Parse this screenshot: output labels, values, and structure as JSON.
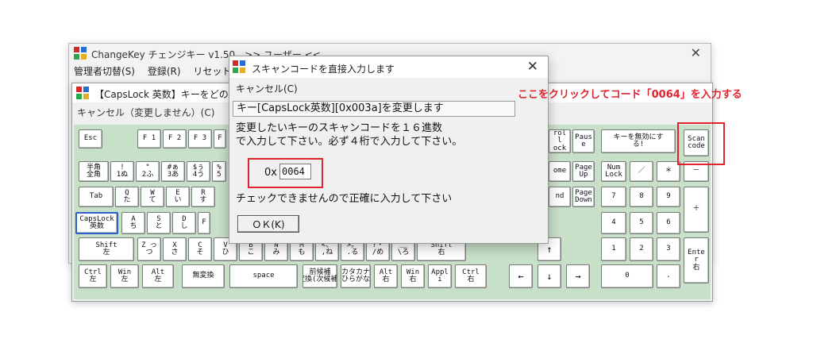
{
  "colors": {
    "accent_red": "#e0232e",
    "keyboard_bg": "#c8dfc8",
    "selected_key_border": "#2f5fc8"
  },
  "main_window": {
    "title": "ChangeKey チェンジキー v1.50　>> ユーザー <<",
    "close_label": "✕",
    "menu": [
      "管理者切替(S)",
      "登録(R)",
      "リセット"
    ]
  },
  "keyboard_window": {
    "title": "【CapsLock 英数】キーをどのキー",
    "menu_label": "キャンセル（変更しません）(C)",
    "keys": [
      {
        "id": "esc",
        "label": "Esc"
      },
      {
        "id": "f1",
        "label": "F 1"
      },
      {
        "id": "f2",
        "label": "F 2"
      },
      {
        "id": "f3",
        "label": "F 3"
      },
      {
        "id": "f4",
        "label": "F"
      },
      {
        "id": "scroll",
        "label": "rol\nl\nock"
      },
      {
        "id": "pause",
        "label": "Paus\ne"
      },
      {
        "id": "disable",
        "label": "キーを無効にす\nる!"
      },
      {
        "id": "scancode",
        "label": "Scan\ncode"
      },
      {
        "id": "hankaku",
        "label": "半角\n全角"
      },
      {
        "id": "k1",
        "label": "!\n1ぬ"
      },
      {
        "id": "k2",
        "label": "\"\n2ふ"
      },
      {
        "id": "k3",
        "label": "#ぁ\n3あ"
      },
      {
        "id": "k4",
        "label": "$ぅ\n4う"
      },
      {
        "id": "k5",
        "label": "%\n5"
      },
      {
        "id": "home",
        "label": "ome"
      },
      {
        "id": "pgup",
        "label": "Page\nUp"
      },
      {
        "id": "numlock",
        "label": "Num\nLock"
      },
      {
        "id": "numdiv",
        "label": "／"
      },
      {
        "id": "nummul",
        "label": "＊"
      },
      {
        "id": "numsub",
        "label": "－"
      },
      {
        "id": "tab",
        "label": "Tab"
      },
      {
        "id": "q",
        "label": "Q\nた"
      },
      {
        "id": "w",
        "label": "W\nて"
      },
      {
        "id": "e",
        "label": "E\nい"
      },
      {
        "id": "r",
        "label": "R\nす"
      },
      {
        "id": "end",
        "label": "nd"
      },
      {
        "id": "pgdn",
        "label": "Page\nDown"
      },
      {
        "id": "n7",
        "label": "7"
      },
      {
        "id": "n8",
        "label": "8"
      },
      {
        "id": "n9",
        "label": "9"
      },
      {
        "id": "numadd",
        "label": "＋"
      },
      {
        "id": "caps",
        "label": "CapsLock\n英数"
      },
      {
        "id": "a",
        "label": "A\nち"
      },
      {
        "id": "s",
        "label": "S\nと"
      },
      {
        "id": "d",
        "label": "D\nし"
      },
      {
        "id": "f",
        "label": "F"
      },
      {
        "id": "n4",
        "label": "4"
      },
      {
        "id": "n5",
        "label": "5"
      },
      {
        "id": "n6",
        "label": "6"
      },
      {
        "id": "lshift",
        "label": "Shift\n左"
      },
      {
        "id": "z",
        "label": "Z っ\nつ"
      },
      {
        "id": "x",
        "label": "X\nさ"
      },
      {
        "id": "c",
        "label": "C\nそ"
      },
      {
        "id": "v",
        "label": "V\nひ"
      },
      {
        "id": "b",
        "label": "B\nこ"
      },
      {
        "id": "n",
        "label": "N\nみ"
      },
      {
        "id": "m",
        "label": "M\nも"
      },
      {
        "id": "comma",
        "label": "<、\n,ね"
      },
      {
        "id": "period",
        "label": ">。\n.る"
      },
      {
        "id": "slash",
        "label": "?・\n/め"
      },
      {
        "id": "backslash",
        "label": "＿\n\\ろ"
      },
      {
        "id": "rshift",
        "label": "Shift\n右"
      },
      {
        "id": "up",
        "label": "↑"
      },
      {
        "id": "n1",
        "label": "1"
      },
      {
        "id": "n2",
        "label": "2"
      },
      {
        "id": "n3",
        "label": "3"
      },
      {
        "id": "enter",
        "label": "Ente\nr\n右"
      },
      {
        "id": "lctrl",
        "label": "Ctrl\n左"
      },
      {
        "id": "lwin",
        "label": "Win\n左"
      },
      {
        "id": "lalt",
        "label": "Alt\n左"
      },
      {
        "id": "muhenkan",
        "label": "無変換"
      },
      {
        "id": "space",
        "label": "space"
      },
      {
        "id": "henkan",
        "label": "前候補\n変換(次候補)"
      },
      {
        "id": "kana",
        "label": "カタカナ\nひらがな"
      },
      {
        "id": "ralt",
        "label": "Alt\n右"
      },
      {
        "id": "rwin",
        "label": "Win\n右"
      },
      {
        "id": "apps",
        "label": "Appl\ni"
      },
      {
        "id": "rctrl",
        "label": "Ctrl\n右"
      },
      {
        "id": "left",
        "label": "←"
      },
      {
        "id": "down",
        "label": "↓"
      },
      {
        "id": "right",
        "label": "→"
      },
      {
        "id": "n0",
        "label": "0"
      },
      {
        "id": "ndot",
        "label": "."
      }
    ]
  },
  "dialog": {
    "title": "スキャンコードを直接入力します",
    "close_label": "✕",
    "menu_label": "キャンセル(C)",
    "key_field": "キー[CapsLock英数][0x003a]を変更します",
    "message": "変更したいキーのスキャンコードを１６進数\nで入力して下さい。必ず４桁で入力して下さい。",
    "prefix": "0x",
    "input_value": "0064",
    "caution": "チェックできませんので正確に入力して下さい",
    "ok_label": "ＯＫ(K)"
  },
  "annotation": "ここをクリックしてコード「0064」を入力する"
}
